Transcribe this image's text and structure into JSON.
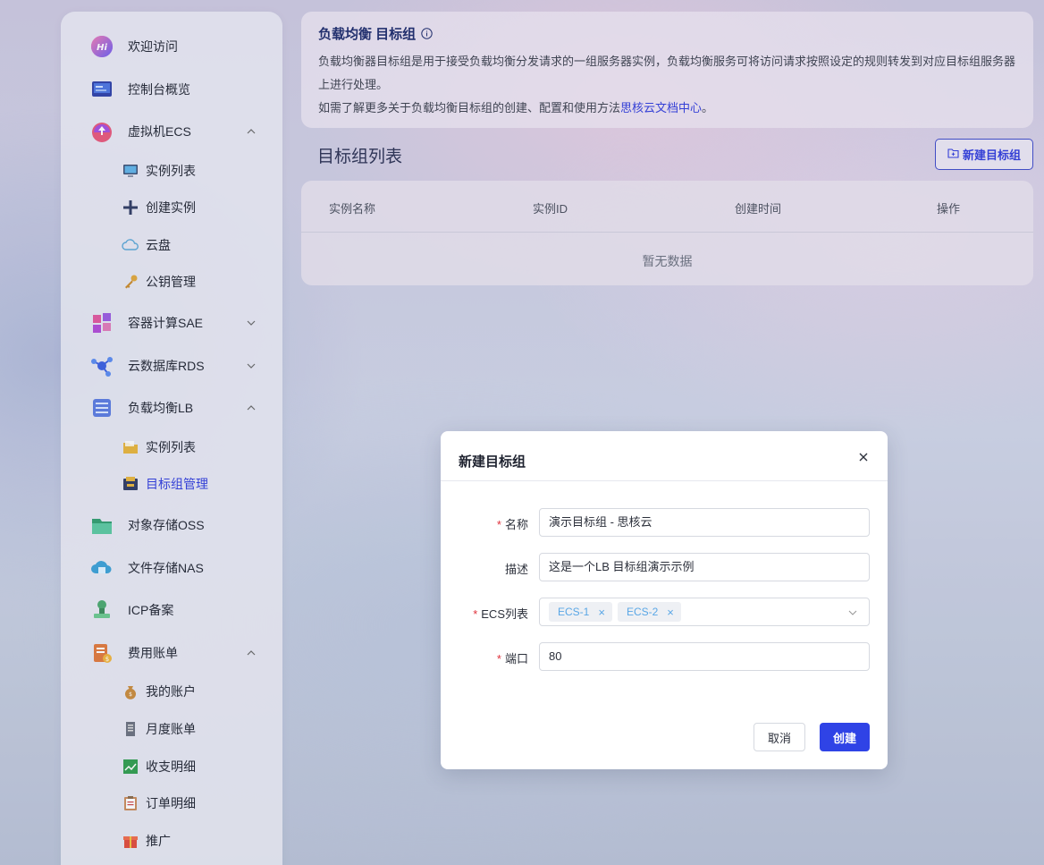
{
  "sidebar": {
    "items": [
      {
        "label": "欢迎访问",
        "icon": "hi-icon"
      },
      {
        "label": "控制台概览",
        "icon": "dashboard-icon"
      },
      {
        "label": "虚拟机ECS",
        "icon": "vm-icon",
        "expanded": true
      },
      {
        "label": "实例列表",
        "icon": "monitor-icon"
      },
      {
        "label": "创建实例",
        "icon": "plus-icon"
      },
      {
        "label": "云盘",
        "icon": "cloud-icon"
      },
      {
        "label": "公钥管理",
        "icon": "key-icon"
      },
      {
        "label": "容器计算SAE",
        "icon": "container-icon",
        "expanded": false
      },
      {
        "label": "云数据库RDS",
        "icon": "database-icon",
        "expanded": false
      },
      {
        "label": "负载均衡LB",
        "icon": "load-balancer-icon",
        "expanded": true
      },
      {
        "label": "实例列表",
        "icon": "folder-icon"
      },
      {
        "label": "目标组管理",
        "icon": "target-group-icon",
        "active": true
      },
      {
        "label": "对象存储OSS",
        "icon": "oss-icon"
      },
      {
        "label": "文件存储NAS",
        "icon": "nas-icon"
      },
      {
        "label": "ICP备案",
        "icon": "stamp-icon"
      },
      {
        "label": "费用账单",
        "icon": "billing-icon",
        "expanded": true
      },
      {
        "label": "我的账户",
        "icon": "money-bag-icon"
      },
      {
        "label": "月度账单",
        "icon": "receipt-icon"
      },
      {
        "label": "收支明细",
        "icon": "chart-icon"
      },
      {
        "label": "订单明细",
        "icon": "clipboard-icon"
      },
      {
        "label": "推广",
        "icon": "gift-icon"
      }
    ]
  },
  "intro": {
    "title": "负载均衡 目标组",
    "line1": "负载均衡器目标组是用于接受负载均衡分发请求的一组服务器实例，负载均衡服务可将访问请求按照设定的规则转发到对应目标组服务器上进行处理。",
    "line2_prefix": "如需了解更多关于负载均衡目标组的创建、配置和使用方法",
    "line2_link": "思核云文档中心",
    "line2_suffix": "。"
  },
  "list": {
    "title": "目标组列表",
    "new_button": "新建目标组",
    "columns": [
      "实例名称",
      "实例ID",
      "创建时间",
      "操作"
    ],
    "empty_text": "暂无数据"
  },
  "modal": {
    "title": "新建目标组",
    "fields": {
      "name": {
        "label": "名称",
        "required": true,
        "value": "演示目标组 - 思核云"
      },
      "desc": {
        "label": "描述",
        "required": false,
        "value": "这是一个LB 目标组演示示例"
      },
      "ecs": {
        "label": "ECS列表",
        "required": true,
        "tags": [
          "ECS-1",
          "ECS-2"
        ]
      },
      "port": {
        "label": "端口",
        "required": true,
        "value": "80"
      }
    },
    "cancel_label": "取消",
    "create_label": "创建"
  },
  "colors": {
    "accent": "#2f3bdc",
    "primary_button": "#2f43e6",
    "required": "#e0323c",
    "tag_text": "#5aa7e6"
  }
}
